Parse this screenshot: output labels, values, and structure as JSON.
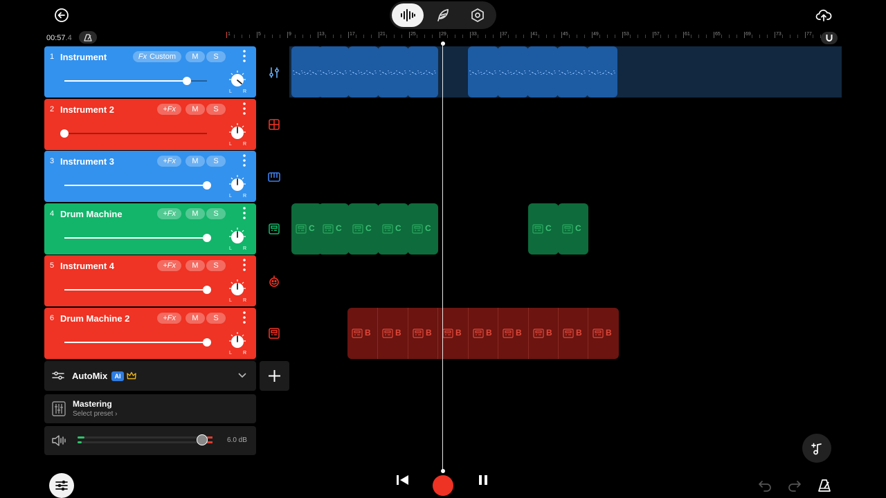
{
  "header": {
    "back_icon": "back-arrow-icon",
    "modes": [
      {
        "icon": "waveform-icon",
        "active": true
      },
      {
        "icon": "feather-icon",
        "active": false
      },
      {
        "icon": "hexagon-settings-icon",
        "active": false
      }
    ],
    "upload_icon": "cloud-upload-icon"
  },
  "timeline": {
    "time_main": "00:57",
    "time_frac": ".4",
    "ruler_labels": [
      "1",
      "5",
      "9",
      "13",
      "17",
      "21",
      "25",
      "29",
      "33",
      "37",
      "41",
      "45",
      "49",
      "53",
      "57",
      "61",
      "65",
      "69",
      "73",
      "77"
    ],
    "snap_icon": "magnet-icon",
    "metronome_icon": "metronome-icon"
  },
  "tracks": [
    {
      "number": "1",
      "name": "Instrument",
      "fx": "Custom",
      "fx_prefix": "Fx",
      "mute": "M",
      "solo": "S",
      "color": "#3392ee",
      "volume": 0.86,
      "pan_icon": "pan-knob",
      "pan_l": "L",
      "pan_r": "R",
      "type_icon": "instrument-sliders-icon"
    },
    {
      "number": "2",
      "name": "Instrument 2",
      "fx": "+Fx",
      "mute": "M",
      "solo": "S",
      "color": "#ef3324",
      "volume": 0.0,
      "pan_l": "L",
      "pan_r": "R",
      "type_icon": "grid-pad-icon"
    },
    {
      "number": "3",
      "name": "Instrument 3",
      "fx": "+Fx",
      "mute": "M",
      "solo": "S",
      "color": "#3392ee",
      "volume": 1.0,
      "pan_l": "L",
      "pan_r": "R",
      "type_icon": "keyboard-icon"
    },
    {
      "number": "4",
      "name": "Drum Machine",
      "fx": "+Fx",
      "mute": "M",
      "solo": "S",
      "color": "#12b56a",
      "volume": 1.0,
      "pan_l": "L",
      "pan_r": "R",
      "type_icon": "drum-machine-icon"
    },
    {
      "number": "5",
      "name": "Instrument 4",
      "fx": "+Fx",
      "mute": "M",
      "solo": "S",
      "color": "#ef3324",
      "volume": 1.0,
      "pan_l": "L",
      "pan_r": "R",
      "type_icon": "robot-icon"
    },
    {
      "number": "6",
      "name": "Drum Machine 2",
      "fx": "+Fx",
      "mute": "M",
      "solo": "S",
      "color": "#ef3324",
      "volume": 1.0,
      "pan_l": "L",
      "pan_r": "R",
      "type_icon": "drum-machine-icon"
    }
  ],
  "clips": {
    "drum_label_c": "C",
    "drum_label_b": "B"
  },
  "automix": {
    "label": "AutoMix",
    "ai_badge": "AI",
    "crown_icon": "crown-icon",
    "chevron_icon": "chevron-down-icon"
  },
  "mastering": {
    "title": "Mastering",
    "subtitle": "Select preset ›"
  },
  "master_volume": {
    "value": "6.0 dB",
    "icon": "speaker-icon"
  },
  "transport": {
    "rewind_icon": "skip-back-icon",
    "record_icon": "record-icon",
    "pause_icon": "pause-icon"
  },
  "bottom": {
    "mixer_icon": "mixer-sliders-icon",
    "undo_icon": "undo-icon",
    "redo_icon": "redo-icon",
    "metronome_icon": "metronome-icon",
    "add_note_icon": "add-note-icon"
  },
  "colors": {
    "blue": "#3392ee",
    "red": "#ef3324",
    "green": "#12b56a",
    "record": "#ee3224"
  }
}
